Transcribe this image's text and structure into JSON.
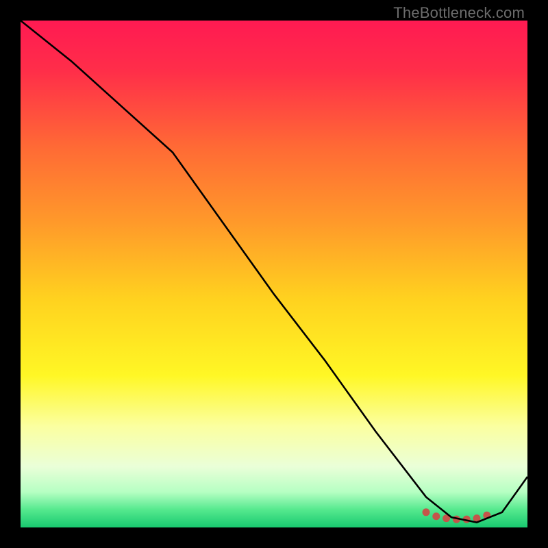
{
  "watermark": "TheBottleneck.com",
  "chart_data": {
    "type": "line",
    "title": "",
    "xlabel": "",
    "ylabel": "",
    "xlim": [
      0,
      100
    ],
    "ylim": [
      0,
      100
    ],
    "series": [
      {
        "name": "curve",
        "x": [
          0,
          10,
          20,
          30,
          40,
          50,
          60,
          70,
          80,
          85,
          90,
          95,
          100
        ],
        "y": [
          100,
          92,
          83,
          74,
          60,
          46,
          33,
          19,
          6,
          2,
          1,
          3,
          10
        ]
      }
    ],
    "markers": {
      "x": [
        80,
        82,
        84,
        86,
        88,
        90,
        92
      ],
      "y": [
        3.0,
        2.2,
        1.8,
        1.6,
        1.6,
        1.8,
        2.4
      ]
    },
    "gradient_stops": [
      {
        "offset": 0.0,
        "color": "#ff1a52"
      },
      {
        "offset": 0.1,
        "color": "#ff2e49"
      },
      {
        "offset": 0.25,
        "color": "#ff6a35"
      },
      {
        "offset": 0.4,
        "color": "#ff9a2a"
      },
      {
        "offset": 0.55,
        "color": "#ffd21f"
      },
      {
        "offset": 0.7,
        "color": "#fff725"
      },
      {
        "offset": 0.8,
        "color": "#fbffa0"
      },
      {
        "offset": 0.88,
        "color": "#eaffd8"
      },
      {
        "offset": 0.93,
        "color": "#b6ffc3"
      },
      {
        "offset": 0.965,
        "color": "#55e98e"
      },
      {
        "offset": 1.0,
        "color": "#18c96f"
      }
    ],
    "marker_color": "#c4554a",
    "line_color": "#000000"
  }
}
